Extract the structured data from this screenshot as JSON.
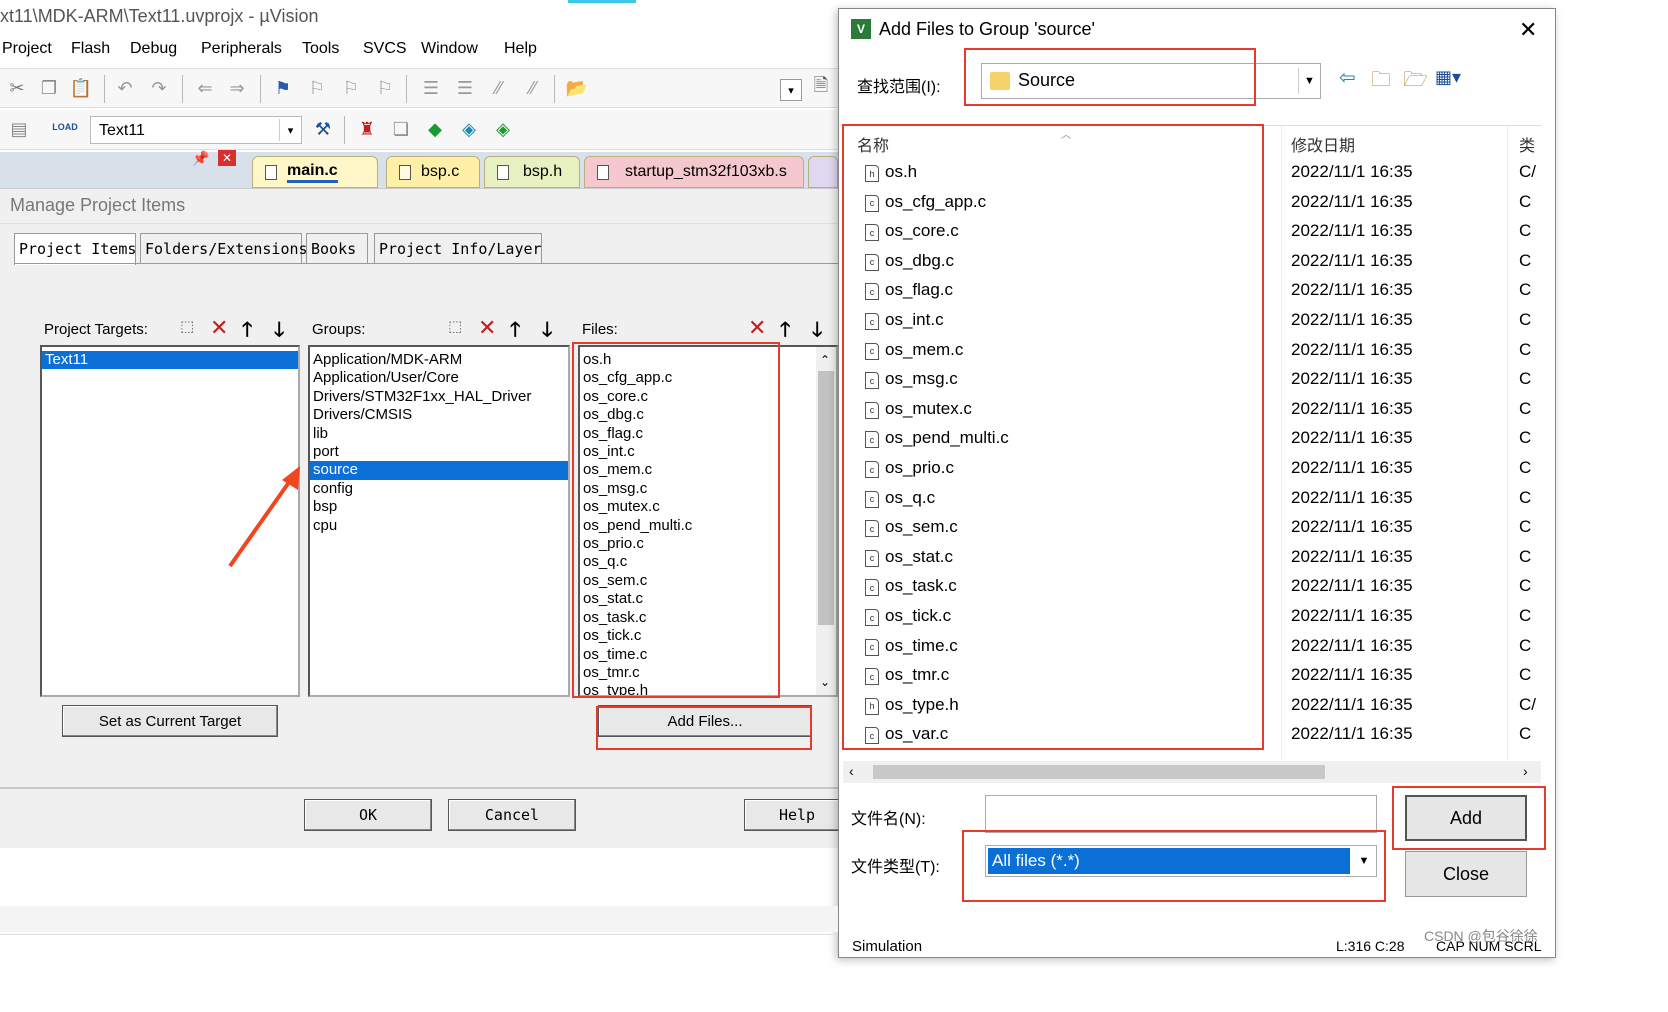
{
  "window": {
    "title": "xt11\\MDK-ARM\\Text11.uvprojx - µVision"
  },
  "menu": [
    "Project",
    "Flash",
    "Debug",
    "Peripherals",
    "Tools",
    "SVCS",
    "Window",
    "Help"
  ],
  "toolbar2": {
    "target_value": "Text11"
  },
  "editor_tabs": [
    "main.c",
    "bsp.c",
    "bsp.h",
    "startup_stm32f103xb.s"
  ],
  "manage": {
    "title": "Manage Project Items",
    "tabs": [
      "Project Items",
      "Folders/Extensions",
      "Books",
      "Project Info/Layer"
    ],
    "targets_label": "Project Targets:",
    "targets": [
      "Text11"
    ],
    "groups_label": "Groups:",
    "groups": [
      "Application/MDK-ARM",
      "Application/User/Core",
      "Drivers/STM32F1xx_HAL_Driver",
      "Drivers/CMSIS",
      "lib",
      "port",
      "source",
      "config",
      "bsp",
      "cpu"
    ],
    "selected_group": "source",
    "files_label": "Files:",
    "files": [
      "os.h",
      "os_cfg_app.c",
      "os_core.c",
      "os_dbg.c",
      "os_flag.c",
      "os_int.c",
      "os_mem.c",
      "os_msg.c",
      "os_mutex.c",
      "os_pend_multi.c",
      "os_prio.c",
      "os_q.c",
      "os_sem.c",
      "os_stat.c",
      "os_task.c",
      "os_tick.c",
      "os_time.c",
      "os_tmr.c",
      "os_type.h"
    ],
    "set_current_label": "Set as Current Target",
    "add_files_label": "Add Files...",
    "ok_label": "OK",
    "cancel_label": "Cancel",
    "help_label": "Help"
  },
  "dialog": {
    "title": "Add Files to Group 'source'",
    "look_in_label": "查找范围(I):",
    "look_in_value": "Source",
    "columns": {
      "name": "名称",
      "date": "修改日期",
      "type": "类"
    },
    "files": [
      {
        "name": "os.h",
        "date": "2022/11/1 16:35",
        "type": "C/",
        "kind": "h"
      },
      {
        "name": "os_cfg_app.c",
        "date": "2022/11/1 16:35",
        "type": "C",
        "kind": "c"
      },
      {
        "name": "os_core.c",
        "date": "2022/11/1 16:35",
        "type": "C",
        "kind": "c"
      },
      {
        "name": "os_dbg.c",
        "date": "2022/11/1 16:35",
        "type": "C",
        "kind": "c"
      },
      {
        "name": "os_flag.c",
        "date": "2022/11/1 16:35",
        "type": "C",
        "kind": "c"
      },
      {
        "name": "os_int.c",
        "date": "2022/11/1 16:35",
        "type": "C",
        "kind": "c"
      },
      {
        "name": "os_mem.c",
        "date": "2022/11/1 16:35",
        "type": "C",
        "kind": "c"
      },
      {
        "name": "os_msg.c",
        "date": "2022/11/1 16:35",
        "type": "C",
        "kind": "c"
      },
      {
        "name": "os_mutex.c",
        "date": "2022/11/1 16:35",
        "type": "C",
        "kind": "c"
      },
      {
        "name": "os_pend_multi.c",
        "date": "2022/11/1 16:35",
        "type": "C",
        "kind": "c"
      },
      {
        "name": "os_prio.c",
        "date": "2022/11/1 16:35",
        "type": "C",
        "kind": "c"
      },
      {
        "name": "os_q.c",
        "date": "2022/11/1 16:35",
        "type": "C",
        "kind": "c"
      },
      {
        "name": "os_sem.c",
        "date": "2022/11/1 16:35",
        "type": "C",
        "kind": "c"
      },
      {
        "name": "os_stat.c",
        "date": "2022/11/1 16:35",
        "type": "C",
        "kind": "c"
      },
      {
        "name": "os_task.c",
        "date": "2022/11/1 16:35",
        "type": "C",
        "kind": "c"
      },
      {
        "name": "os_tick.c",
        "date": "2022/11/1 16:35",
        "type": "C",
        "kind": "c"
      },
      {
        "name": "os_time.c",
        "date": "2022/11/1 16:35",
        "type": "C",
        "kind": "c"
      },
      {
        "name": "os_tmr.c",
        "date": "2022/11/1 16:35",
        "type": "C",
        "kind": "c"
      },
      {
        "name": "os_type.h",
        "date": "2022/11/1 16:35",
        "type": "C/",
        "kind": "h"
      },
      {
        "name": "os_var.c",
        "date": "2022/11/1 16:35",
        "type": "C",
        "kind": "c"
      }
    ],
    "filename_label": "文件名(N):",
    "filename_value": "",
    "filetype_label": "文件类型(T):",
    "filetype_value": "All files (*.*)",
    "add_label": "Add",
    "close_label": "Close"
  },
  "statusbar": {
    "left": "Simulation",
    "pos": "L:316 C:28",
    "keys": "CAP NUM SCRL"
  },
  "watermark": "CSDN @包谷徐徐",
  "colors": {
    "selection": "#0a6fd6",
    "highlight_box": "#e8392c",
    "tab_main": "#fff7c8",
    "tab_startup": "#f4c8cc"
  }
}
